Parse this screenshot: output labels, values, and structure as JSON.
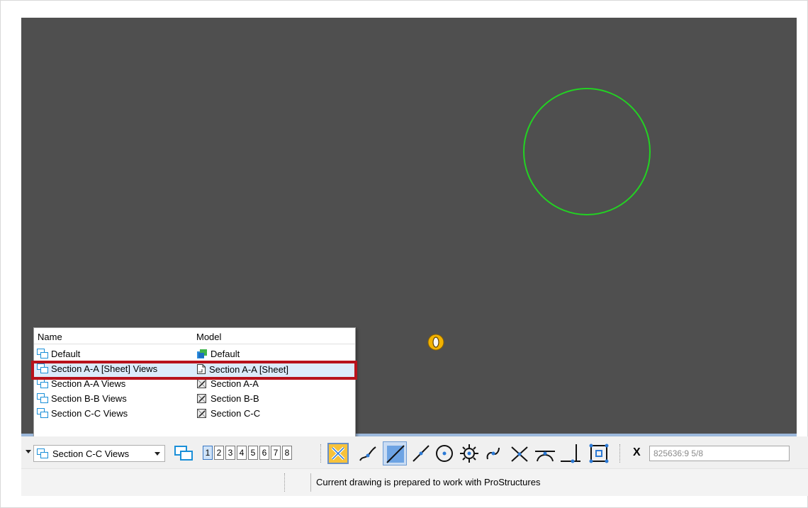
{
  "view_list": {
    "headers": {
      "name": "Name",
      "model": "Model"
    },
    "rows": [
      {
        "name": "Default",
        "model": "Default",
        "model_icon": "default-model-icon",
        "selected": false
      },
      {
        "name": "Section A-A [Sheet] Views",
        "model": "Section A-A [Sheet]",
        "model_icon": "sheet-model-icon",
        "selected": true
      },
      {
        "name": "Section A-A Views",
        "model": "Section A-A",
        "model_icon": "drawing-model-icon",
        "selected": false
      },
      {
        "name": "Section B-B Views",
        "model": "Section B-B",
        "model_icon": "drawing-model-icon",
        "selected": false
      },
      {
        "name": "Section C-C Views",
        "model": "Section C-C",
        "model_icon": "drawing-model-icon",
        "selected": false
      }
    ]
  },
  "toolbar": {
    "saved_view_select": "Section C-C Views",
    "view_numbers": [
      "1",
      "2",
      "3",
      "4",
      "5",
      "6",
      "7",
      "8"
    ],
    "active_view": "1",
    "x_label": "X",
    "x_coordinate": "825636:9 5/8",
    "snap_tools": [
      "snap-clear-icon",
      "keypoint-snap-icon",
      "area-snap-icon",
      "nearest-snap-icon",
      "center-snap-icon",
      "origin-snap-icon",
      "bisector-snap-icon",
      "intersection-snap-icon",
      "tangent-snap-icon",
      "perpendicular-snap-icon",
      "accudraw-icon"
    ]
  },
  "status": {
    "message": "Current drawing is prepared to work with ProStructures"
  },
  "colors": {
    "canvas": "#4f4f4f",
    "circle": "#22d322",
    "highlight": "#b8121c",
    "cursor": "#f2b200"
  }
}
